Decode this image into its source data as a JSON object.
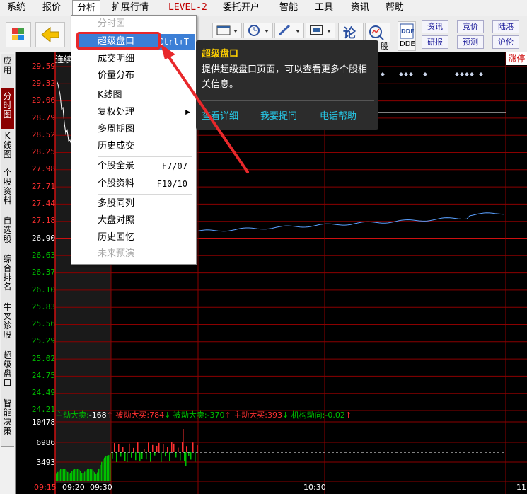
{
  "menubar": {
    "items": [
      "系统",
      "报价",
      "分析",
      "扩展行情",
      "LEVEL-2",
      "委托开户",
      "智能",
      "工具",
      "资讯",
      "帮助"
    ]
  },
  "toolbar": {
    "partial_labels": [
      "股",
      "DDE"
    ],
    "buttons": [
      "资讯",
      "竞价",
      "陆港",
      "研报",
      "预测",
      "沪伦"
    ],
    "price_tag": "涨停"
  },
  "left_tabs": [
    {
      "label": "应用",
      "active": false
    },
    {
      "label": "分时图",
      "active": true
    },
    {
      "label": "K线图",
      "active": false
    },
    {
      "label": "个股资料",
      "active": false
    },
    {
      "label": "自选股",
      "active": false
    },
    {
      "label": "综合排名",
      "active": false
    },
    {
      "label": "牛叉诊股",
      "active": false
    },
    {
      "label": "超级盘口",
      "active": false
    },
    {
      "label": "智能决策",
      "active": false
    }
  ],
  "chart": {
    "series_label": "连续",
    "price_levels": [
      "29.59",
      "29.32",
      "29.06",
      "28.79",
      "28.52",
      "28.25",
      "27.98",
      "27.71",
      "27.44",
      "27.18",
      "26.90",
      "26.63",
      "26.37",
      "26.10",
      "25.83",
      "25.56",
      "25.29",
      "25.02",
      "24.75",
      "24.49",
      "24.21"
    ],
    "reference_price": "26.90",
    "volume_levels": [
      "10478",
      "6986",
      "3493"
    ],
    "time_labels": [
      "09:15",
      "09:20",
      "09:30",
      "10:30",
      "11"
    ],
    "indicators": [
      {
        "label": "主动大卖:",
        "value": "-168",
        "color": "#ff3030"
      },
      {
        "label": "被动大买:",
        "value": "784",
        "color": "#ff3030"
      },
      {
        "label": "被动大卖:",
        "value": "-370",
        "color": "#00c000"
      },
      {
        "label": "主动大买:",
        "value": "393",
        "color": "#ff3030"
      },
      {
        "label": "机构动向:",
        "value": "-0.02",
        "color": "#00c000"
      }
    ],
    "colors": {
      "up": "#ff3030",
      "down": "#00c000",
      "price_line": "#5aa0ff",
      "grid": "#8b0000"
    }
  },
  "dropdown": {
    "items": [
      {
        "label": "分时图",
        "shortcut": "",
        "state": "disabled"
      },
      {
        "label": "超级盘口",
        "shortcut": "Ctrl+T",
        "state": "highlighted"
      },
      {
        "label": "成交明细",
        "shortcut": "",
        "state": "normal"
      },
      {
        "label": "价量分布",
        "shortcut": "",
        "state": "normal"
      },
      {
        "label": "K线图",
        "shortcut": "",
        "state": "normal"
      },
      {
        "label": "复权处理",
        "shortcut": "",
        "state": "submenu"
      },
      {
        "label": "多周期图",
        "shortcut": "",
        "state": "normal"
      },
      {
        "label": "历史成交",
        "shortcut": "",
        "state": "normal"
      },
      {
        "label": "个股全景",
        "shortcut": "F7/07",
        "state": "normal"
      },
      {
        "label": "个股资料",
        "shortcut": "F10/10",
        "state": "normal"
      },
      {
        "label": "多股同列",
        "shortcut": "",
        "state": "normal"
      },
      {
        "label": "大盘对照",
        "shortcut": "",
        "state": "normal"
      },
      {
        "label": "历史回忆",
        "shortcut": "",
        "state": "normal"
      },
      {
        "label": "未来预演",
        "shortcut": "",
        "state": "disabled"
      }
    ]
  },
  "tooltip": {
    "title": "超级盘口",
    "description": "提供超级盘口页面，可以查看更多个股相关信息。",
    "links": [
      "查看详细",
      "我要提问",
      "电话帮助"
    ]
  }
}
